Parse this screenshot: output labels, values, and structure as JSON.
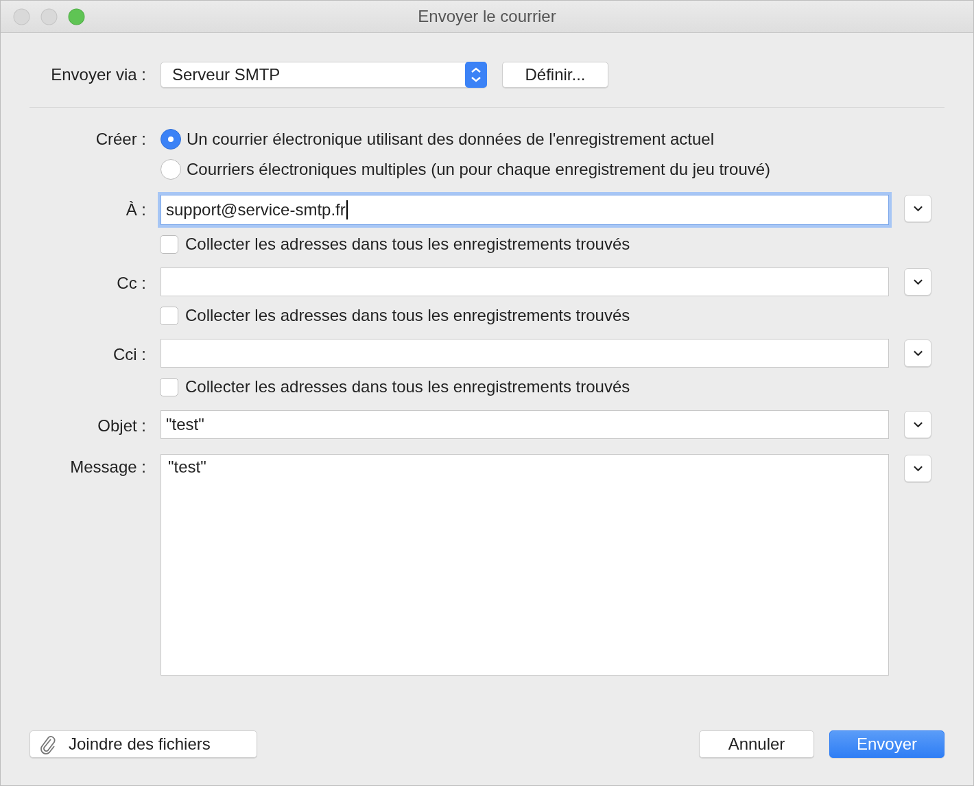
{
  "window": {
    "title": "Envoyer le courrier"
  },
  "send_via": {
    "label": "Envoyer via :",
    "value": "Serveur SMTP",
    "button": "Définir..."
  },
  "create": {
    "label": "Créer :",
    "options": [
      {
        "label": "Un courrier électronique utilisant des données de l'enregistrement actuel",
        "selected": true
      },
      {
        "label": "Courriers électroniques multiples (un pour chaque enregistrement du jeu trouvé)",
        "selected": false
      }
    ]
  },
  "fields": [
    {
      "kind": "line",
      "label": "À :",
      "value": "support@service-smtp.fr",
      "focused": true,
      "collect": {
        "label": "Collecter les adresses dans tous les enregistrements trouvés",
        "checked": false
      }
    },
    {
      "kind": "line",
      "label": "Cc :",
      "focused": false,
      "collect": {
        "label": "Collecter les adresses dans tous les enregistrements trouvés",
        "checked": false
      }
    },
    {
      "kind": "line",
      "label": "Cci :",
      "focused": false,
      "collect": {
        "label": "Collecter les adresses dans tous les enregistrements trouvés",
        "checked": false
      }
    },
    {
      "kind": "line",
      "label": "Objet :",
      "value": "\"test\"",
      "focused": false
    },
    {
      "kind": "area",
      "label": "Message :",
      "value": "\"test\"",
      "focused": false
    }
  ],
  "footer": {
    "attach": "Joindre des fichiers",
    "cancel": "Annuler",
    "send": "Envoyer"
  }
}
